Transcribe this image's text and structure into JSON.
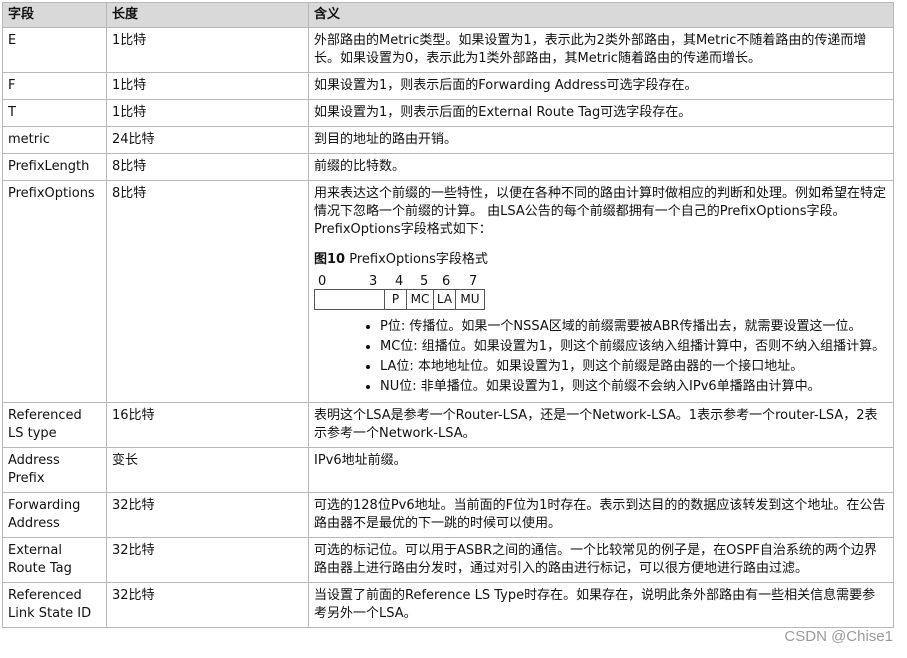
{
  "header": {
    "field": "字段",
    "length": "长度",
    "meaning": "含义"
  },
  "rows": [
    {
      "field": "E",
      "length": "1比特",
      "meaning": "外部路由的Metric类型。如果设置为1，表示此为2类外部路由，其Metric不随着路由的传递而增长。如果设置为0，表示此为1类外部路由，其Metric随着路由的传递而增长。"
    },
    {
      "field": "F",
      "length": "1比特",
      "meaning": "如果设置为1，则表示后面的Forwarding Address可选字段存在。"
    },
    {
      "field": "T",
      "length": "1比特",
      "meaning": "如果设置为1，则表示后面的External Route Tag可选字段存在。"
    },
    {
      "field": "metric",
      "length": "24比特",
      "meaning": "到目的地址的路由开销。"
    },
    {
      "field": "PrefixLength",
      "length": "8比特",
      "meaning": "前缀的比特数。"
    },
    {
      "field": "PrefixOptions",
      "length": "8比特",
      "meaning": "用来表达这个前缀的一些特性，以便在各种不同的路由计算时做相应的判断和处理。例如希望在特定情况下忽略一个前缀的计算。 由LSA公告的每个前缀都拥有一个自己的PrefixOptions字段。PrefixOptions字段格式如下：",
      "figure": {
        "caption_bold": "图10",
        "caption_text": " PrefixOptions字段格式",
        "bit_numbers": [
          "0",
          "3",
          "4",
          "5",
          "6",
          "7"
        ],
        "bits": [
          "",
          "P",
          "MC",
          "LA",
          "MU"
        ]
      },
      "bullets": [
        "P位: 传播位。如果一个NSSA区域的前缀需要被ABR传播出去，就需要设置这一位。",
        "MC位: 组播位。如果设置为1，则这个前缀应该纳入组播计算中，否则不纳入组播计算。",
        "LA位: 本地地址位。如果设置为1，则这个前缀是路由器的一个接口地址。",
        "NU位: 非单播位。如果设置为1，则这个前缀不会纳入IPv6单播路由计算中。"
      ]
    },
    {
      "field": "Referenced LS type",
      "length": "16比特",
      "meaning": "表明这个LSA是参考一个Router-LSA，还是一个Network-LSA。1表示参考一个router-LSA，2表示参考一个Network-LSA。"
    },
    {
      "field": "Address Prefix",
      "length": "变长",
      "meaning": "IPv6地址前缀。"
    },
    {
      "field": "Forwarding Address",
      "length": "32比特",
      "meaning": "可选的128位Pv6地址。当前面的F位为1时存在。表示到达目的的数据应该转发到这个地址。在公告路由器不是最优的下一跳的时候可以使用。"
    },
    {
      "field": "External Route Tag",
      "length": "32比特",
      "meaning": "可选的标记位。可以用于ASBR之间的通信。一个比较常见的例子是，在OSPF自治系统的两个边界路由器上进行路由分发时，通过对引入的路由进行标记，可以很方便地进行路由过滤。"
    },
    {
      "field": "Referenced Link State ID",
      "length": "32比特",
      "meaning": "当设置了前面的Reference LS Type时存在。如果存在，说明此条外部路由有一些相关信息需要参考另外一个LSA。"
    }
  ],
  "watermark": "CSDN @Chise1"
}
